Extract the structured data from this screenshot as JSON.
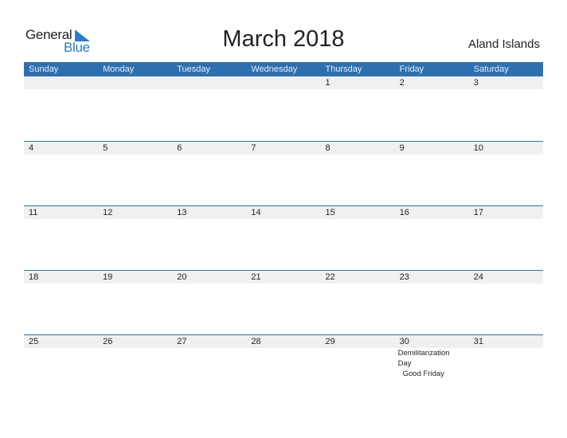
{
  "logo": {
    "line1": "General",
    "line2": "Blue"
  },
  "title": "March 2018",
  "region": "Aland Islands",
  "weekdays": [
    "Sunday",
    "Monday",
    "Tuesday",
    "Wednesday",
    "Thursday",
    "Friday",
    "Saturday"
  ],
  "weeks": [
    [
      "",
      "",
      "",
      "",
      "1",
      "2",
      "3"
    ],
    [
      "4",
      "5",
      "6",
      "7",
      "8",
      "9",
      "10"
    ],
    [
      "11",
      "12",
      "13",
      "14",
      "15",
      "16",
      "17"
    ],
    [
      "18",
      "19",
      "20",
      "21",
      "22",
      "23",
      "24"
    ],
    [
      "25",
      "26",
      "27",
      "28",
      "29",
      "30",
      "31"
    ]
  ],
  "events": {
    "mar30": [
      "Demilitarization Day",
      "Good Friday"
    ]
  },
  "colors": {
    "accent": "#2e6fb0",
    "row_bg": "#f0f0f0",
    "logo_blue": "#2b7bd0"
  }
}
